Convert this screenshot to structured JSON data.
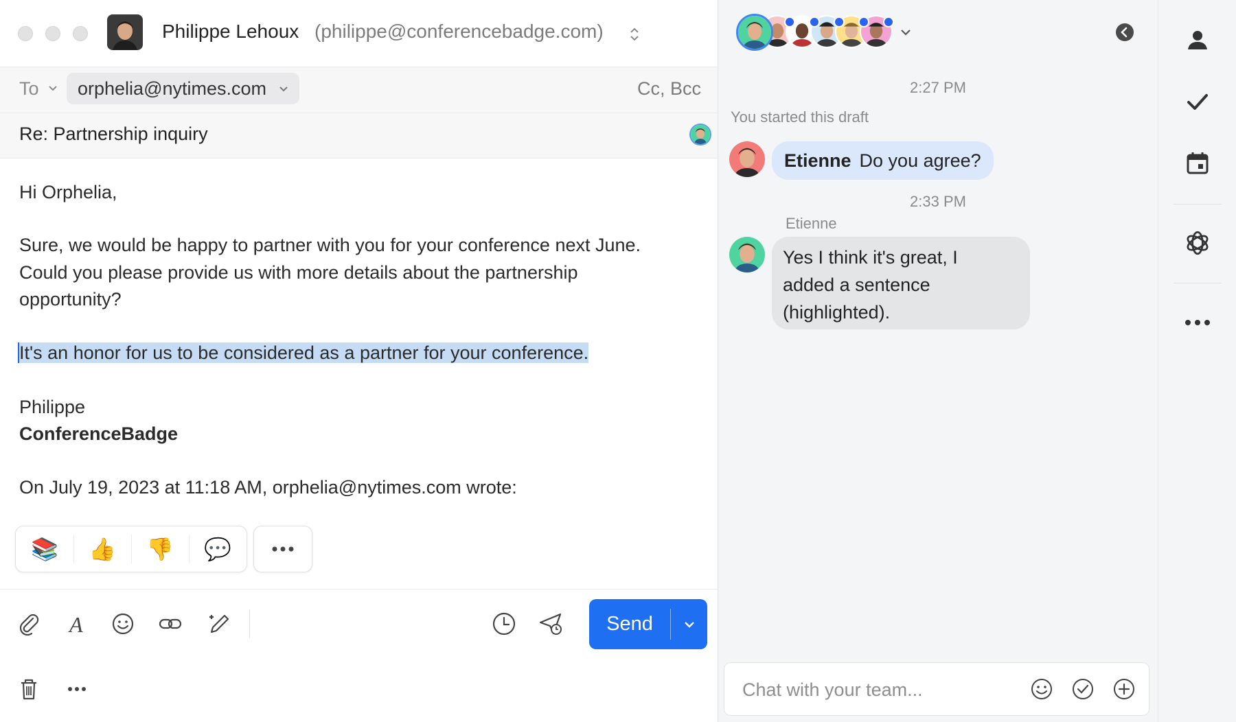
{
  "colors": {
    "accent": "#1f6ff2",
    "highlight": "#c6dcf5",
    "chat_bubble_mine": "#dbe8fb",
    "chat_bubble_other": "#e4e5e7",
    "presence_dot": "#2a63f0"
  },
  "composer": {
    "from_name": "Philippe Lehoux",
    "from_email": "(philippe@conferencebadge.com)",
    "to_label": "To",
    "to_recipient": "orphelia@nytimes.com",
    "cc_bcc_label": "Cc, Bcc",
    "subject": "Re: Partnership inquiry",
    "body": {
      "greeting": "Hi Orphelia,",
      "para1_line1": "Sure, we would be happy to partner with you for your conference next June.",
      "para1_line2": "Could you please provide us with more details about the partnership",
      "para1_line3": "opportunity?",
      "highlighted_sentence": "It's an honor for us to be considered as a partner for your conference.",
      "signature_name": "Philippe",
      "signature_company": "ConferenceBadge",
      "quote_header": "On July 19, 2023 at 11:18 AM, orphelia@nytimes.com wrote:"
    },
    "reactions": [
      {
        "icon": "books-icon",
        "glyph": "📚"
      },
      {
        "icon": "thumbs-up-icon",
        "glyph": "👍"
      },
      {
        "icon": "thumbs-down-icon",
        "glyph": "👎"
      },
      {
        "icon": "speech-bubble-icon",
        "glyph": "💬"
      }
    ],
    "send_label": "Send"
  },
  "chat": {
    "messages": [
      {
        "time": "2:27 PM",
        "system": "You started this draft"
      },
      {
        "author": "Etienne",
        "text": "Do you agree?"
      },
      {
        "time": "2:33 PM",
        "author_label": "Etienne",
        "text_lines": [
          "Yes I think it's great, I",
          "added a sentence",
          "(highlighted)."
        ]
      }
    ],
    "input_placeholder": "Chat with your team..."
  }
}
